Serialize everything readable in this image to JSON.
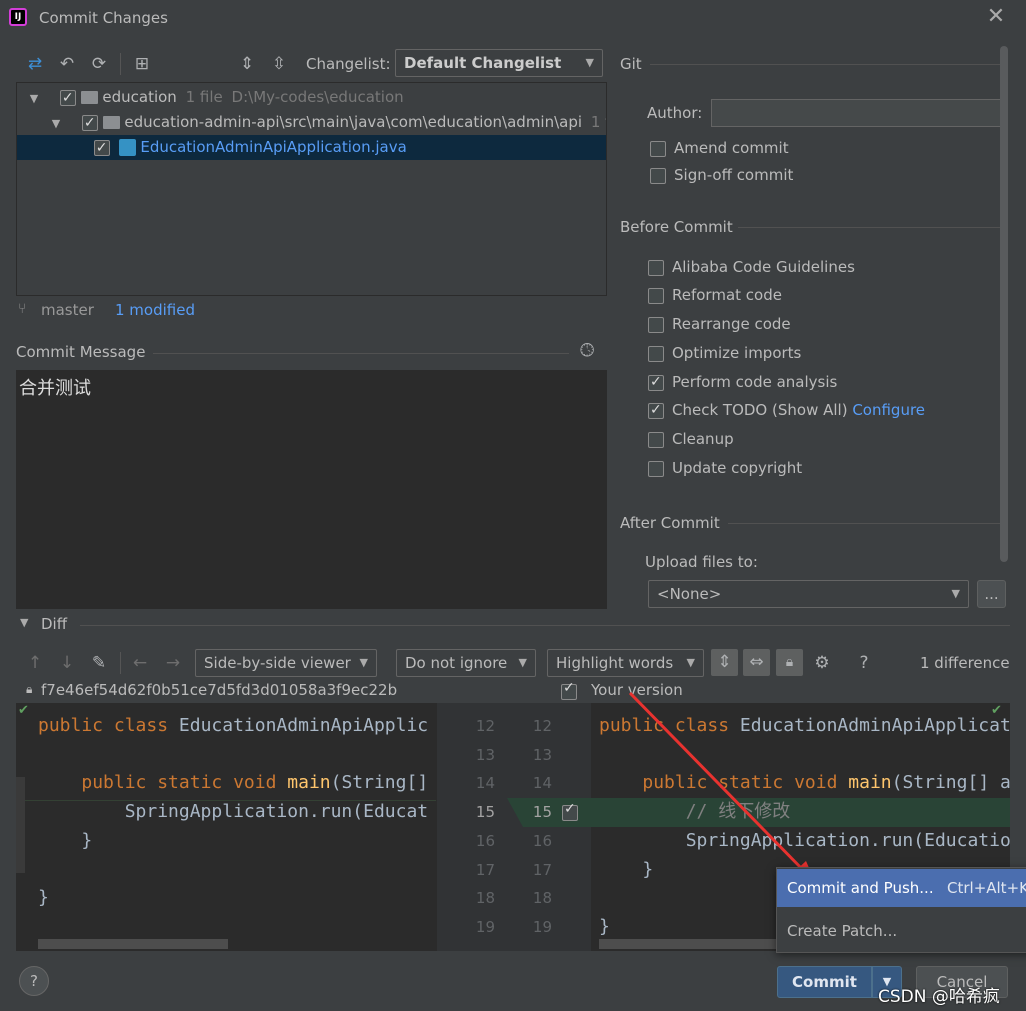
{
  "window": {
    "title": "Commit Changes",
    "logo": "IJ"
  },
  "toolbar": {
    "changelist_label": "Changelist:",
    "changelist_value": "Default Changelist"
  },
  "tree": {
    "root": {
      "name": "education",
      "count": "1 file",
      "path": "D:\\My-codes\\education"
    },
    "module": {
      "name": "education-admin-api\\src\\main\\java\\com\\education\\admin\\api",
      "count": "1 file"
    },
    "file": {
      "name": "EducationAdminApiApplication.java"
    }
  },
  "status": {
    "branch": "master",
    "modified": "1 modified"
  },
  "commit_message": {
    "label": "Commit Message",
    "text": "合并测试"
  },
  "git": {
    "title": "Git",
    "author_label": "Author:",
    "author_value": "",
    "amend": "Amend commit",
    "signoff": "Sign-off commit"
  },
  "before_commit": {
    "title": "Before Commit",
    "items": [
      {
        "label": "Alibaba Code Guidelines",
        "checked": false
      },
      {
        "label": "Reformat code",
        "checked": false
      },
      {
        "label": "Rearrange code",
        "checked": false
      },
      {
        "label": "Optimize imports",
        "checked": false
      },
      {
        "label": "Perform code analysis",
        "checked": true
      },
      {
        "label": "Check TODO (Show All)",
        "checked": true,
        "link": "Configure"
      },
      {
        "label": "Cleanup",
        "checked": false
      },
      {
        "label": "Update copyright",
        "checked": false
      }
    ]
  },
  "after_commit": {
    "title": "After Commit",
    "upload_label": "Upload files to:",
    "upload_value": "<None>",
    "browse": "..."
  },
  "diff": {
    "title": "Diff",
    "viewer": "Side-by-side viewer",
    "ignore": "Do not ignore",
    "highlight": "Highlight words",
    "help": "?",
    "differences": "1 difference",
    "left_hash": "f7e46ef54d62f0b51ce7d5fd3d01058a3f9ec22b",
    "right_label": "Your version",
    "left_lines": [
      {
        "n": "12",
        "code": "public class EducationAdminApiApplic"
      },
      {
        "n": "13",
        "code": ""
      },
      {
        "n": "14",
        "code": "    public static void main(String[]"
      },
      {
        "n": "15",
        "code": "        SpringApplication.run(Educat"
      },
      {
        "n": "16",
        "code": "    }"
      },
      {
        "n": "17",
        "code": ""
      },
      {
        "n": "18",
        "code": "}"
      },
      {
        "n": "19",
        "code": ""
      }
    ],
    "right_lines": [
      {
        "n": "12",
        "code": "public class EducationAdminApiApplicat"
      },
      {
        "n": "13",
        "code": ""
      },
      {
        "n": "14",
        "code": "    public static void main(String[] a"
      },
      {
        "n": "15",
        "code": "        // 线下修改"
      },
      {
        "n": "16",
        "code": "        SpringApplication.run(Educatio"
      },
      {
        "n": "17",
        "code": "    }"
      },
      {
        "n": "18",
        "code": ""
      },
      {
        "n": "19",
        "code": "}"
      }
    ]
  },
  "popup": {
    "push": "Commit and Push...",
    "push_shortcut": "Ctrl+Alt+K",
    "patch": "Create Patch..."
  },
  "buttons": {
    "commit": "Commit",
    "cancel": "Cancel",
    "help": "?"
  },
  "watermark": "CSDN @哈希疯"
}
